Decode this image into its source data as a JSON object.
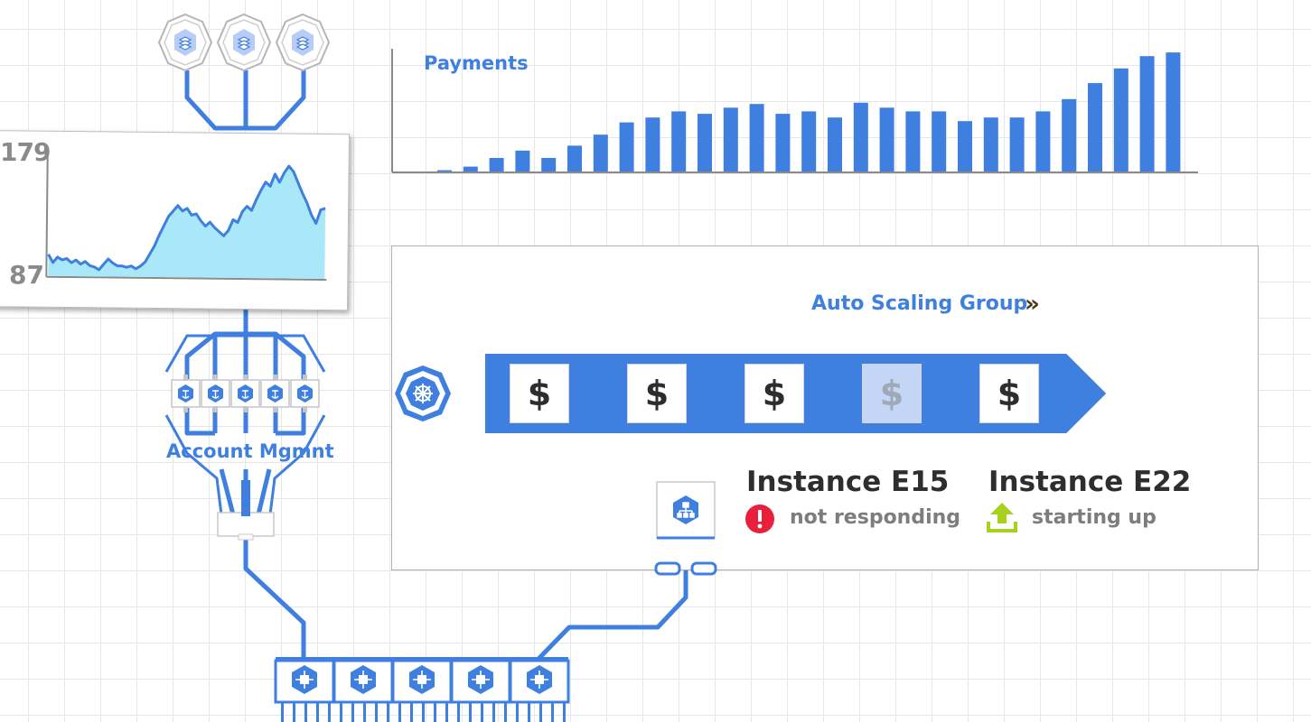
{
  "line_chart": {
    "max_label": "179",
    "min_label": "87",
    "fill_color": "#a8e8f8",
    "line_color": "#3f7fdf"
  },
  "bar_chart": {
    "title": "Payments",
    "bar_color": "#3f7fdf"
  },
  "chart_data": [
    {
      "type": "area",
      "ylim": [
        87,
        179
      ],
      "values": [
        103,
        97,
        101,
        99,
        100,
        97,
        99,
        96,
        98,
        95,
        94,
        92,
        96,
        100,
        97,
        95,
        95,
        94,
        95,
        93,
        95,
        98,
        104,
        110,
        118,
        125,
        132,
        136,
        140,
        136,
        138,
        133,
        134,
        129,
        125,
        128,
        124,
        121,
        118,
        122,
        130,
        128,
        136,
        140,
        137,
        145,
        152,
        158,
        155,
        164,
        158,
        165,
        170,
        166,
        158,
        150,
        143,
        134,
        128,
        138,
        139
      ],
      "title": "",
      "xlabel": "",
      "ylabel": ""
    },
    {
      "type": "bar",
      "title": "Payments",
      "values": [
        1,
        4,
        11,
        17,
        11,
        21,
        30,
        40,
        44,
        49,
        47,
        52,
        55,
        47,
        49,
        44,
        56,
        52,
        49,
        49,
        41,
        44,
        44,
        49,
        59,
        72,
        84,
        94,
        97
      ],
      "xlabel": "",
      "ylabel": ""
    }
  ],
  "top_nodes": {
    "icon": "database-stack-icon",
    "count": 3
  },
  "account": {
    "label": "Account Mgmnt"
  },
  "asg": {
    "title": "Auto Scaling Group",
    "chevron": "»",
    "instances": [
      {
        "symbol": "$",
        "dim": false
      },
      {
        "symbol": "$",
        "dim": false
      },
      {
        "symbol": "$",
        "dim": false
      },
      {
        "symbol": "$",
        "dim": true
      },
      {
        "symbol": "$",
        "dim": false
      }
    ]
  },
  "instance_e15": {
    "name": "Instance E15",
    "status": "not responding",
    "status_icon": "alert-icon",
    "status_color": "#e8203b"
  },
  "instance_e22": {
    "name": "Instance E22",
    "status": "starting up",
    "status_icon": "upload-icon",
    "status_color": "#a6d21e"
  },
  "colors": {
    "accent": "#3f7fdf",
    "wire": "#3f7fdf"
  }
}
